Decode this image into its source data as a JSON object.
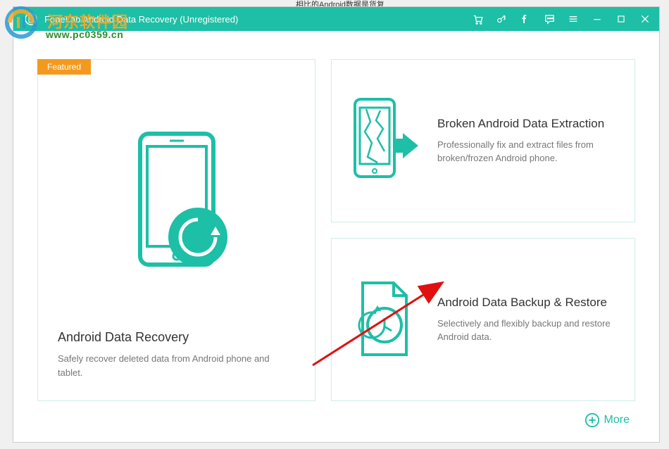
{
  "titlebar": {
    "title": "FoneLab Android Data Recovery (Unregistered)"
  },
  "watermark": {
    "cn_text": "河东软件园",
    "url": "www.pc0359.cn"
  },
  "featured_label": "Featured",
  "cards": {
    "recovery": {
      "title": "Android Data Recovery",
      "desc": "Safely recover deleted data from Android phone and tablet."
    },
    "broken": {
      "title": "Broken Android Data Extraction",
      "desc": "Professionally fix and extract files from broken/frozen Android phone."
    },
    "backup": {
      "title": "Android Data Backup & Restore",
      "desc": "Selectively and flexibly backup and restore Android data."
    }
  },
  "more_label": "More",
  "colors": {
    "accent": "#1dbfa6",
    "featured": "#f39a1e"
  }
}
